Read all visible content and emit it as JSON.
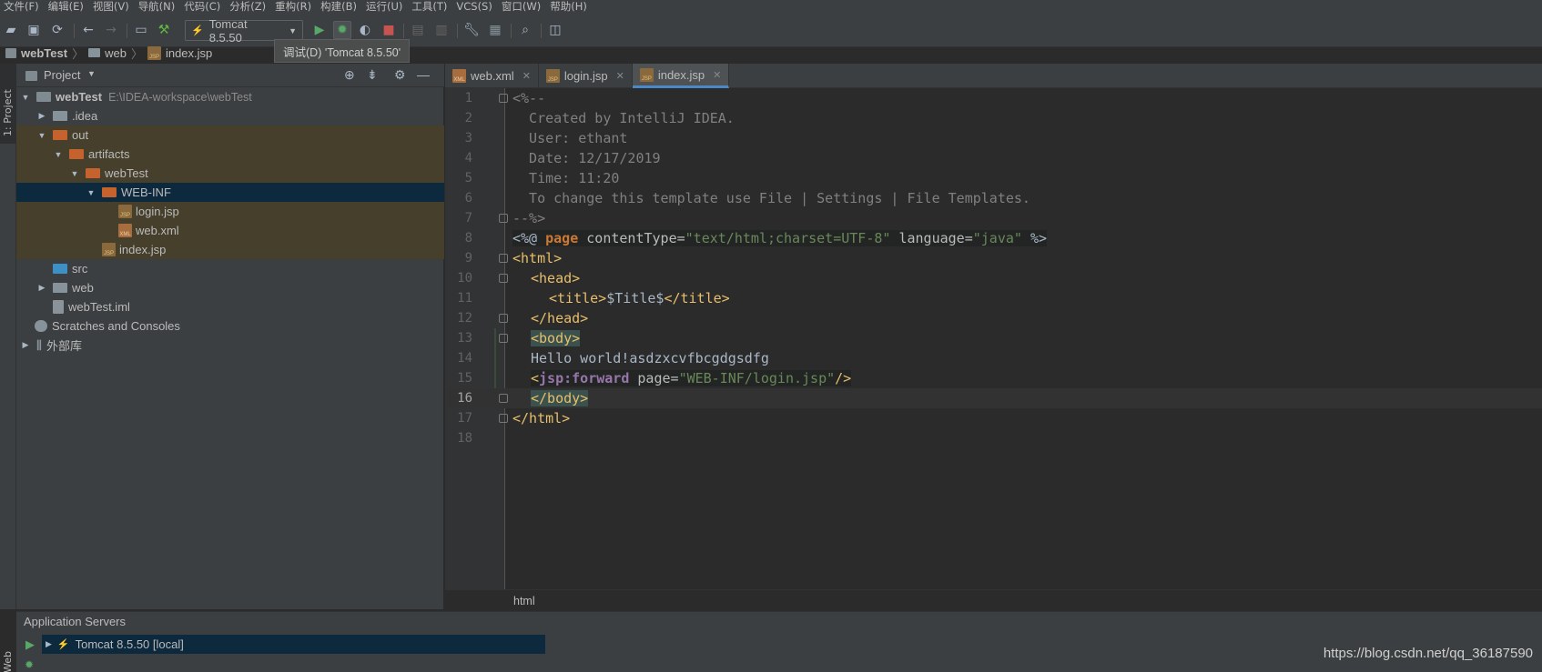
{
  "menu": [
    "文件(F)",
    "编辑(E)",
    "视图(V)",
    "导航(N)",
    "代码(C)",
    "分析(Z)",
    "重构(R)",
    "构建(B)",
    "运行(U)",
    "工具(T)",
    "VCS(S)",
    "窗口(W)",
    "帮助(H)"
  ],
  "toolbar": {
    "run_config": "Tomcat 8.5.50"
  },
  "tooltip": "调试(D) 'Tomcat 8.5.50'",
  "breadcrumb": [
    "webTest",
    "web",
    "index.jsp"
  ],
  "left_strip": {
    "project_tab": "1: Project",
    "web_tab": "Web"
  },
  "project_panel": {
    "title": "Project",
    "tree": [
      {
        "label": "webTest",
        "path": "E:\\IDEA-workspace\\webTest"
      },
      {
        "label": ".idea"
      },
      {
        "label": "out"
      },
      {
        "label": "artifacts"
      },
      {
        "label": "webTest"
      },
      {
        "label": "WEB-INF"
      },
      {
        "label": "login.jsp"
      },
      {
        "label": "web.xml"
      },
      {
        "label": "index.jsp"
      },
      {
        "label": "src"
      },
      {
        "label": "web"
      },
      {
        "label": "webTest.iml"
      },
      {
        "label": "Scratches and Consoles"
      },
      {
        "label": "外部库"
      }
    ]
  },
  "editor": {
    "tabs": [
      "web.xml",
      "login.jsp",
      "index.jsp"
    ],
    "active_tab": "index.jsp",
    "line_numbers": [
      "1",
      "2",
      "3",
      "4",
      "5",
      "6",
      "7",
      "8",
      "9",
      "10",
      "11",
      "12",
      "13",
      "14",
      "15",
      "16",
      "17",
      "18"
    ],
    "code": {
      "l1": "<%--",
      "l2": "  Created by IntelliJ IDEA.",
      "l3": "  User: ethant",
      "l4": "  Date: 12/17/2019",
      "l5": "  Time: 11:20",
      "l6": "  To change this template use File | Settings | File Templates.",
      "l7": "--%>",
      "l8a": "<%@ ",
      "l8b": "page",
      "l8c": " contentType=",
      "l8d": "\"text/html;charset=UTF-8\"",
      "l8e": " language=",
      "l8f": "\"java\"",
      "l8g": " %>",
      "l9": "<html>",
      "l10": "<head>",
      "l11a": "<title>",
      "l11b": "$Title$",
      "l11c": "</title>",
      "l12": "</head>",
      "l13": "<body>",
      "l14": "Hello world!asdzxcvfbcgdgsdfg",
      "l15a": "<",
      "l15b": "jsp:forward",
      "l15c": " page=",
      "l15d": "\"WEB-INF/login.jsp\"",
      "l15e": "/>",
      "l16": "</body>",
      "l17": "</html>"
    },
    "breadcrumb_footer": "html"
  },
  "services": {
    "title": "Application Servers",
    "server": "Tomcat 8.5.50 [local]"
  },
  "watermark": "https://blog.csdn.net/qq_36187590",
  "colors": {
    "accent": "#4a88c7",
    "selection": "#0d293e",
    "excluded": "#463f2c"
  }
}
